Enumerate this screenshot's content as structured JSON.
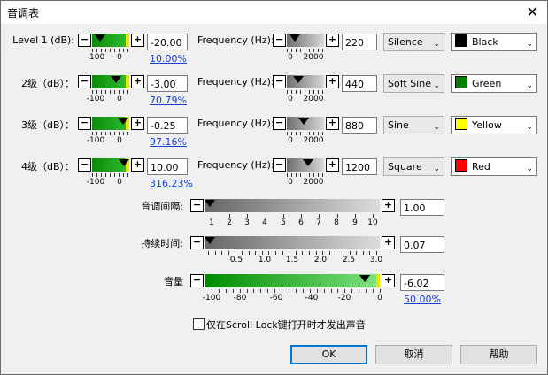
{
  "window": {
    "title": "音调表"
  },
  "rows": [
    {
      "label": "Level 1 (dB):",
      "level_value": "-20.00",
      "level_pct": "10.00%",
      "level_fill": 0.1,
      "freq_label": "Frequency (Hz):",
      "freq_value": "220",
      "freq_fill": 0.11,
      "wave": "Silence",
      "color_name": "Black",
      "color_hex": "#000000"
    },
    {
      "label": "2级（dB）：",
      "level_value": "-3.00",
      "level_pct": "70.79%",
      "level_fill": 0.708,
      "freq_label": "Frequency (Hz):",
      "freq_value": "440",
      "freq_fill": 0.22,
      "wave": "Soft Sine",
      "color_name": "Green",
      "color_hex": "#008000"
    },
    {
      "label": "3级（dB）：",
      "level_value": "-0.25",
      "level_pct": "97.16%",
      "level_fill": 0.972,
      "freq_label": "Frequency (Hz):",
      "freq_value": "880",
      "freq_fill": 0.44,
      "wave": "Sine",
      "color_name": "Yellow",
      "color_hex": "#ffff00"
    },
    {
      "label": "4级（dB）：",
      "level_value": "10.00",
      "level_pct": "316.23%",
      "level_fill": 1.0,
      "freq_label": "Frequency (Hz):",
      "freq_value": "1200",
      "freq_fill": 0.6,
      "wave": "Square",
      "color_name": "Red",
      "color_hex": "#ff0000"
    }
  ],
  "level_ticks": [
    "-100",
    "0"
  ],
  "freq_ticks": [
    "0",
    "2000"
  ],
  "interval": {
    "label": "音调间隔:",
    "value": "1.00",
    "ticks": [
      "1",
      "2",
      "3",
      "4",
      "5",
      "6",
      "7",
      "8",
      "9",
      "10"
    ],
    "fraction": 0.0
  },
  "duration": {
    "label": "持续时间:",
    "value": "0.07",
    "ticks": [
      "0.5",
      "1.0",
      "1.5",
      "2.0",
      "2.5",
      "3.0"
    ],
    "fraction": 0.0
  },
  "volume": {
    "label": "音量",
    "value": "-6.02",
    "pct": "50.00%",
    "ticks": [
      "-100",
      "-80",
      "-60",
      "-40",
      "-20",
      "0"
    ],
    "fraction": 0.94
  },
  "scroll_lock": {
    "label": "仅在Scroll Lock键打开时才发出声音",
    "checked": false
  },
  "buttons": {
    "ok": "OK",
    "cancel": "取消",
    "help": "帮助"
  },
  "glyphs": {
    "minus": "−",
    "plus": "+",
    "close": "✕",
    "caret": "⌄"
  }
}
